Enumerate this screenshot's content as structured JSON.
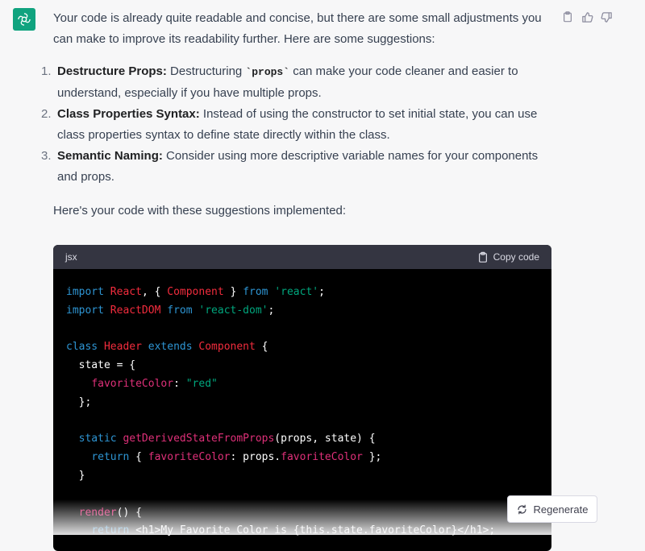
{
  "message": {
    "intro": "Your code is already quite readable and concise, but there are some small adjustments you can make to improve its readability further. Here are some suggestions:",
    "items": [
      {
        "number": "1.",
        "title": "Destructure Props:",
        "text_before": "Destructuring ",
        "code": "`props`",
        "text_after": " can make your code cleaner and easier to understand, especially if you have multiple props."
      },
      {
        "number": "2.",
        "title": "Class Properties Syntax:",
        "text": "Instead of using the constructor to set initial state, you can use class properties syntax to define state directly within the class."
      },
      {
        "number": "3.",
        "title": "Semantic Naming:",
        "text": "Consider using more descriptive variable names for your components and props."
      }
    ],
    "outro": "Here's your code with these suggestions implemented:"
  },
  "code_block": {
    "language": "jsx",
    "copy_label": "Copy code",
    "lines": [
      "import React, { Component } from 'react';",
      "import ReactDOM from 'react-dom';",
      "",
      "class Header extends Component {",
      "  state = {",
      "    favoriteColor: \"red\"",
      "  };",
      "",
      "  static getDerivedStateFromProps(props, state) {",
      "    return { favoriteColor: props.favoriteColor };",
      "  }",
      "",
      "  render() {",
      "    return <h1>My Favorite Color is {this.state.favoriteColor}</h1>;"
    ]
  },
  "regenerate_label": "Regenerate",
  "icons": {
    "avatar": "openai-logo-icon",
    "copy": "clipboard-icon",
    "like": "thumbs-up-icon",
    "dislike": "thumbs-down-icon",
    "regenerate": "refresh-icon"
  },
  "colors": {
    "avatar_bg": "#10a37f",
    "code_bg": "#000000",
    "code_header_bg": "#343541",
    "keyword": "#2e95d3",
    "class_name": "#f22c3d",
    "string": "#00a67d",
    "function": "#df3079"
  }
}
